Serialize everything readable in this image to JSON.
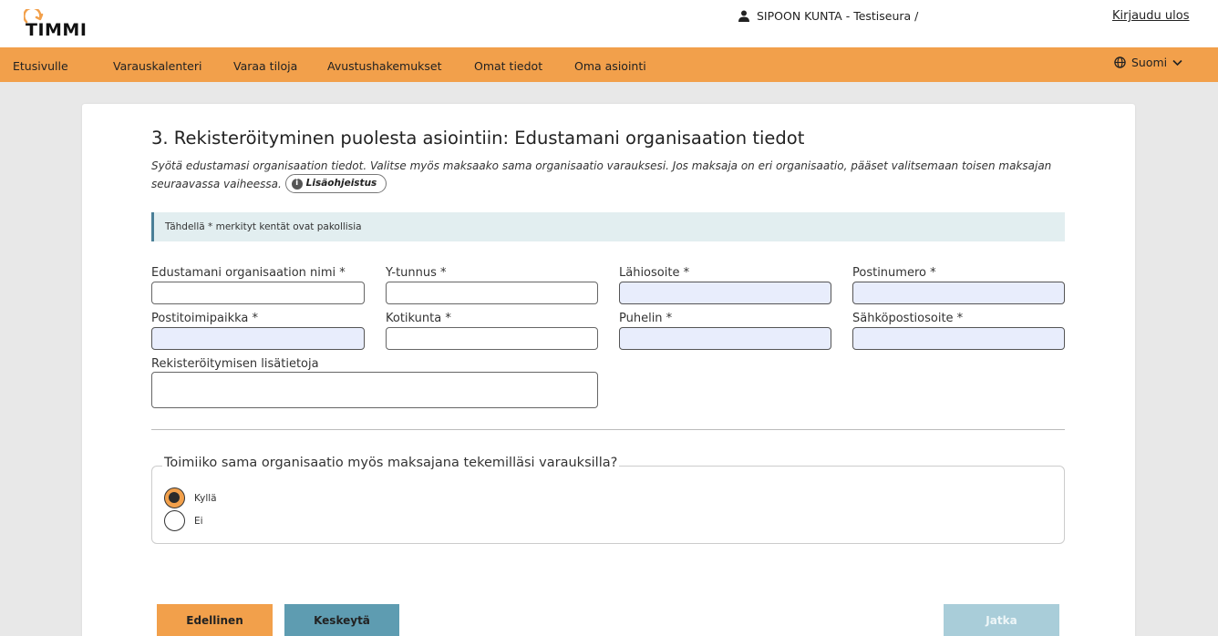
{
  "header": {
    "logo_text": "TIMMI",
    "user_label": "SIPOON KUNTA - Testiseura /",
    "logout_label": "Kirjaudu ulos"
  },
  "nav": {
    "items": [
      "Etusivulle",
      "Varauskalenteri",
      "Varaa tiloja",
      "Avustushakemukset",
      "Omat tiedot",
      "Oma asiointi"
    ],
    "language": "Suomi"
  },
  "page": {
    "title": "3. Rekisteröityminen puolesta asiointiin: Edustamani organisaation tiedot",
    "intro": "Syötä edustamasi organisaation tiedot. Valitse myös maksaako sama organisaatio varauksesi. Jos maksaja on eri organisaatio, pääset valitsemaan toisen maksajan seuraavassa vaiheessa.",
    "help_button": "Lisäohjeistus",
    "required_notice": "Tähdellä * merkityt kentät ovat pakollisia"
  },
  "form": {
    "fields": [
      {
        "label": "Edustamani organisaation nimi *",
        "value": "",
        "autofilled": false
      },
      {
        "label": "Y-tunnus *",
        "value": "",
        "autofilled": false
      },
      {
        "label": "Lähiosoite *",
        "value": "",
        "autofilled": true
      },
      {
        "label": "Postinumero *",
        "value": "",
        "autofilled": true
      },
      {
        "label": "Postitoimipaikka *",
        "value": "",
        "autofilled": true
      },
      {
        "label": "Kotikunta *",
        "value": "",
        "autofilled": false
      },
      {
        "label": "Puhelin *",
        "value": "",
        "autofilled": true
      },
      {
        "label": "Sähköpostiosoite *",
        "value": "",
        "autofilled": true
      },
      {
        "label": "Rekisteröitymisen lisätietoja",
        "value": "",
        "autofilled": false
      }
    ],
    "payer_question": "Toimiiko sama organisaatio myös maksajana tekemilläsi varauksilla?",
    "payer_options": [
      {
        "label": "Kyllä",
        "selected": true
      },
      {
        "label": "Ei",
        "selected": false
      }
    ]
  },
  "buttons": {
    "previous": "Edellinen",
    "cancel": "Keskeytä",
    "next": "Jatka"
  },
  "colors": {
    "accent": "#f2a04b",
    "secondary": "#5e9cb1",
    "disabled": "#a9cdd9",
    "autofill": "#e8edfc"
  }
}
